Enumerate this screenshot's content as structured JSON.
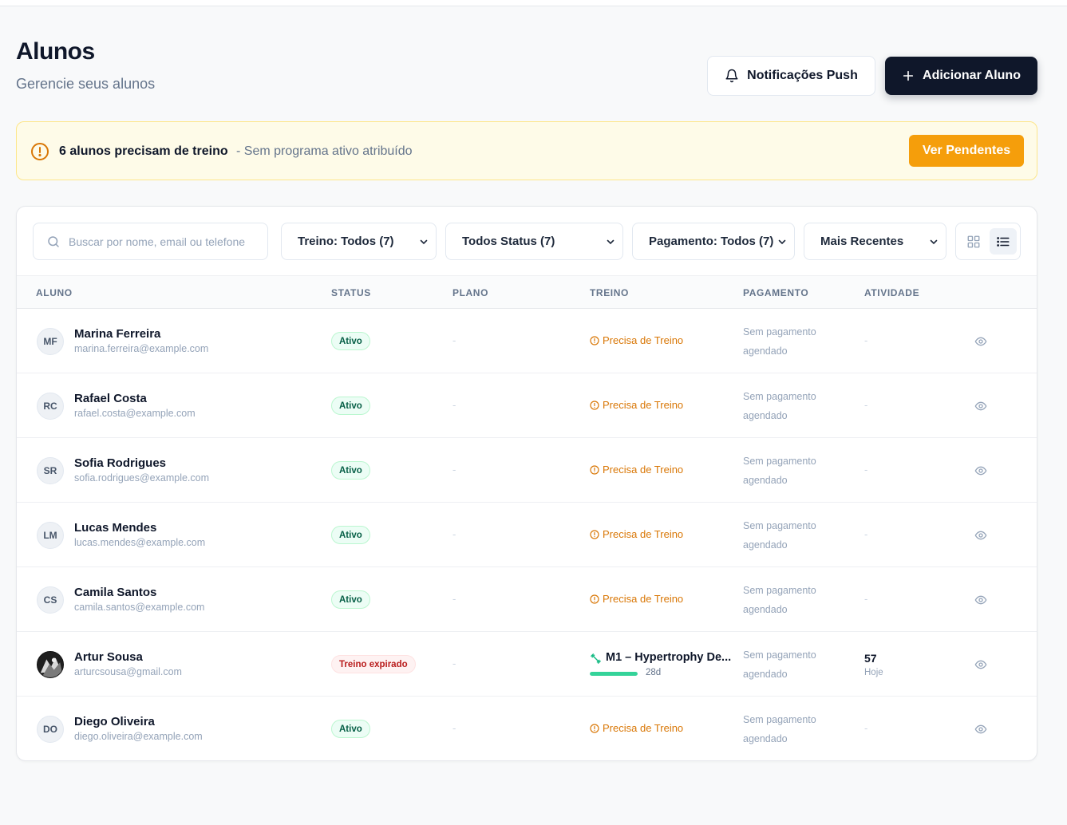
{
  "header": {
    "title": "Alunos",
    "subtitle": "Gerencie seus alunos",
    "push_button": "Notificações Push",
    "add_button": "Adicionar Aluno"
  },
  "alert": {
    "strong": "6 alunos precisam de treino",
    "sub": "- Sem programa ativo atribuído",
    "button": "Ver Pendentes"
  },
  "filters": {
    "search_placeholder": "Buscar por nome, email ou telefone",
    "treino": "Treino: Todos (7)",
    "status": "Todos Status (7)",
    "pagamento": "Pagamento: Todos (7)",
    "sort": "Mais Recentes"
  },
  "columns": {
    "aluno": "ALUNO",
    "status": "STATUS",
    "plano": "PLANO",
    "treino": "TREINO",
    "pagamento": "PAGAMENTO",
    "atividade": "ATIVIDADE"
  },
  "rows": [
    {
      "initials": "MF",
      "name": "Marina Ferreira",
      "email": "marina.ferreira@example.com",
      "status": "Ativo",
      "plano": "-",
      "treino": "Precisa de Treino",
      "pay1": "Sem pagamento",
      "pay2": "agendado",
      "atividade": "-"
    },
    {
      "initials": "RC",
      "name": "Rafael Costa",
      "email": "rafael.costa@example.com",
      "status": "Ativo",
      "plano": "-",
      "treino": "Precisa de Treino",
      "pay1": "Sem pagamento",
      "pay2": "agendado",
      "atividade": "-"
    },
    {
      "initials": "SR",
      "name": "Sofia Rodrigues",
      "email": "sofia.rodrigues@example.com",
      "status": "Ativo",
      "plano": "-",
      "treino": "Precisa de Treino",
      "pay1": "Sem pagamento",
      "pay2": "agendado",
      "atividade": "-"
    },
    {
      "initials": "LM",
      "name": "Lucas Mendes",
      "email": "lucas.mendes@example.com",
      "status": "Ativo",
      "plano": "-",
      "treino": "Precisa de Treino",
      "pay1": "Sem pagamento",
      "pay2": "agendado",
      "atividade": "-"
    },
    {
      "initials": "CS",
      "name": "Camila Santos",
      "email": "camila.santos@example.com",
      "status": "Ativo",
      "plano": "-",
      "treino": "Precisa de Treino",
      "pay1": "Sem pagamento",
      "pay2": "agendado",
      "atividade": "-"
    },
    {
      "initials": "",
      "name": "Artur Sousa",
      "email": "arturcsousa@gmail.com",
      "status": "Treino expirado",
      "plano": "-",
      "program": "M1 – Hypertrophy De...",
      "program_days": "28d",
      "program_progress": 1.0,
      "pay1": "Sem pagamento",
      "pay2": "agendado",
      "atividade": "57",
      "atividade_sub": "Hoje"
    },
    {
      "initials": "DO",
      "name": "Diego Oliveira",
      "email": "diego.oliveira@example.com",
      "status": "Ativo",
      "plano": "-",
      "treino": "Precisa de Treino",
      "pay1": "Sem pagamento",
      "pay2": "agendado",
      "atividade": "-"
    }
  ],
  "colors": {
    "primary": "#0f172a",
    "warning": "#f59e0b",
    "warning_text": "#d97706",
    "success_bg": "#ecfdf5",
    "danger_text": "#b91c1c",
    "progress": "#34d399"
  }
}
